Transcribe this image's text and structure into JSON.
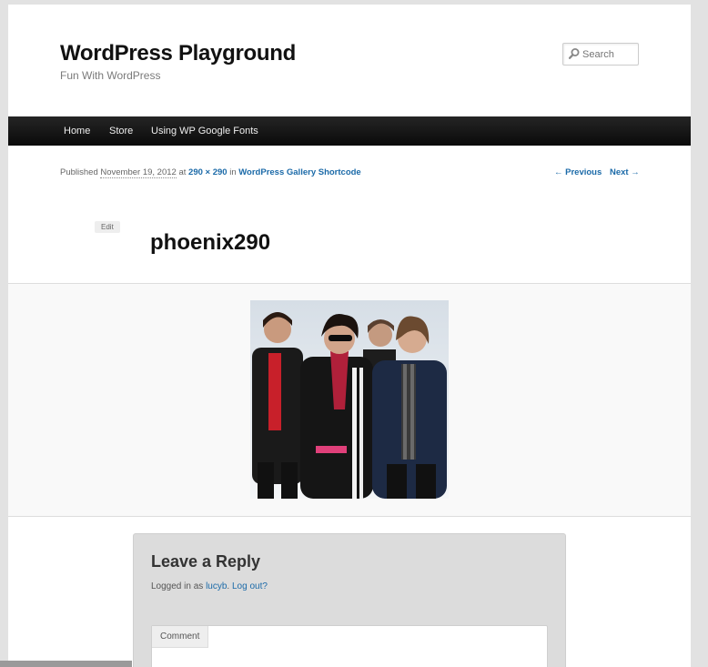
{
  "site": {
    "title": "WordPress Playground",
    "description": "Fun With WordPress"
  },
  "search": {
    "placeholder": "Search"
  },
  "nav": {
    "items": [
      {
        "label": "Home"
      },
      {
        "label": "Store"
      },
      {
        "label": "Using WP Google Fonts"
      }
    ]
  },
  "entry_meta": {
    "published": "Published",
    "date": "November 19, 2012",
    "at": "at",
    "size": "290 × 290",
    "in": "in",
    "gallery": "WordPress Gallery Shortcode"
  },
  "post_nav": {
    "previous": "← Previous",
    "next": "Next →"
  },
  "edit_label": "Edit",
  "entry_title": "phoenix290",
  "reply": {
    "title": "Leave a Reply",
    "logged_in_prefix": "Logged in as",
    "user": "lucyb",
    "logout": "Log out?",
    "comment_label": "Comment"
  },
  "colors": {
    "link": "#1b6aa8",
    "nav_bg": "#111111"
  }
}
